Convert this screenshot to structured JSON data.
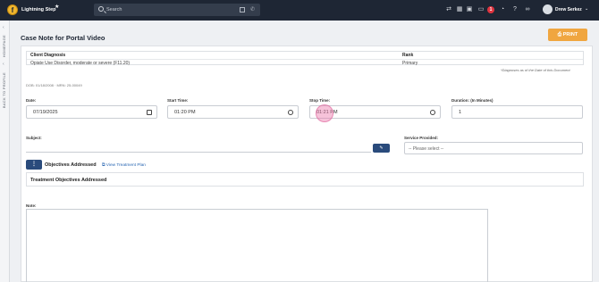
{
  "app": {
    "logo_letter": "f",
    "name": "Lightning Step",
    "star": "★"
  },
  "search": {
    "placeholder": "Search"
  },
  "header_icons": [
    "refresh-icon",
    "calendar-icon",
    "grid-icon",
    "chat-icon",
    "bell-icon",
    "help-icon",
    "link-icon"
  ],
  "notifications": {
    "count": "1"
  },
  "user": {
    "name": "Drew Serkez"
  },
  "rail": {
    "homepage": "HOMEPAGE",
    "back": "BACK TO PROFILE"
  },
  "page": {
    "title": "Case Note for Portal Video",
    "print_label": "PRINT"
  },
  "diagnosis": {
    "col1_header": "Client Diagnosis",
    "col2_header": "Rank",
    "col1_value": "Opiate Use Disorder, moderate or severe (F11.20)",
    "col2_value": "Primary",
    "note": "*Diagnoses as of the Date of this Document"
  },
  "client_meta": "DOB: 01/18/2008 · MRN: 25-00049",
  "fields": {
    "date_label": "Date:",
    "date_value": "07/19/2025",
    "start_label": "Start Time:",
    "start_value": "01:20 PM",
    "stop_label": "Stop Time:",
    "stop_value": "01:21 PM",
    "duration_label": "Duration: (In Minutes)",
    "duration_value": "1",
    "subject_label": "Subject:",
    "service_label": "Service Provided:",
    "service_placeholder": "-- Please select --"
  },
  "objectives": {
    "button_glyph": "⋮",
    "label": "Objectives Addressed",
    "link": "View Treatment Plan",
    "box_title": "Treatment Objectives Addressed"
  },
  "note": {
    "label": "Note:"
  }
}
